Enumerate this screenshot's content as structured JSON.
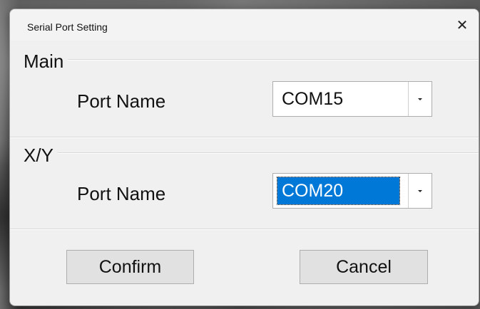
{
  "window": {
    "title": "Serial Port Setting",
    "close_glyph": "✕"
  },
  "groups": [
    {
      "title": "Main",
      "field_label": "Port Name",
      "selected_port": "COM15",
      "focused": false
    },
    {
      "title": "X/Y",
      "field_label": "Port Name",
      "selected_port": "COM20",
      "focused": true
    }
  ],
  "buttons": {
    "confirm": "Confirm",
    "cancel": "Cancel"
  },
  "icons": {
    "close": "close-icon",
    "dropdown": "chevron-down-icon"
  },
  "colors": {
    "dialog_bg": "#f0f0f0",
    "selection": "#0078d7",
    "button_bg": "#e1e1e1"
  }
}
